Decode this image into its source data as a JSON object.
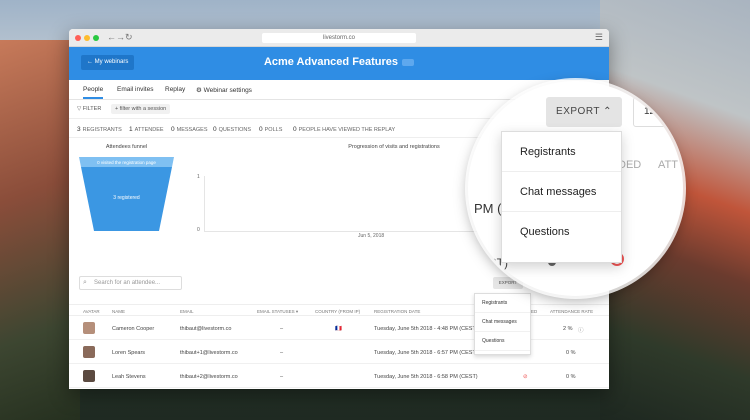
{
  "browser": {
    "url": "livestorm.co"
  },
  "header": {
    "back_label": "← My webinars",
    "title": "Acme Advanced Features",
    "brand_color": "#2f8de4"
  },
  "tabs": [
    {
      "label": "People",
      "active": true
    },
    {
      "label": "Email invites"
    },
    {
      "label": "Replay"
    },
    {
      "label": "Webinar settings"
    }
  ],
  "filters": {
    "filter_label": "FILTER",
    "add_label": "+ filter with a session"
  },
  "stats": [
    {
      "value": "3",
      "label": "REGISTRANTS"
    },
    {
      "value": "1",
      "label": "ATTENDEE"
    },
    {
      "value": "0",
      "label": "MESSAGES"
    },
    {
      "value": "0",
      "label": "QUESTIONS"
    },
    {
      "value": "0",
      "label": "POLLS"
    },
    {
      "value": "0",
      "label": "PEOPLE HAVE VIEWED THE REPLAY"
    }
  ],
  "funnel": {
    "title": "Attendees funnel",
    "top_label": "0 visited the registration page",
    "bottom_label": "3 registered"
  },
  "progression": {
    "title": "Progression of visits and registrations",
    "y_top": "1",
    "y_bottom": "0",
    "x_label": "Jun 5, 2018"
  },
  "search": {
    "placeholder": "Search for an attendee..."
  },
  "export": {
    "small_label": "EXPORT",
    "zoom_label": "EXPORT"
  },
  "export_menu": [
    "Registrants",
    "Chat messages",
    "Questions"
  ],
  "table": {
    "headers": [
      "AVATAR",
      "NAME",
      "EMAIL",
      "EMAIL STATUSES ▾",
      "COUNTRY (FROM IP)",
      "REGISTRATION DATE",
      "ED",
      "ATTENDANCE RATE"
    ],
    "rows": [
      {
        "name": "Cameron Cooper",
        "email": "thibaut@livestorm.co",
        "status": "–",
        "country": "🇫🇷",
        "date": "Tuesday, June 5th 2018 - 4:48 PM (CEST)",
        "rate": "2 %"
      },
      {
        "name": "Loren Spears",
        "email": "thibaut+1@livestorm.co",
        "status": "–",
        "country": "",
        "date": "Tuesday, June 5th 2018 - 6:57 PM (CEST)",
        "rate": "0 %"
      },
      {
        "name": "Leah Stevens",
        "email": "thibaut+2@livestorm.co",
        "status": "–",
        "country": "",
        "date": "Tuesday, June 5th 2018 - 6:58 PM (CEST)",
        "rate": "0 %"
      }
    ]
  },
  "zoom": {
    "partial_box": "12",
    "col_ded": "DED",
    "col_att": "ATT",
    "pm": "PM (",
    "cest": "CEST)"
  }
}
